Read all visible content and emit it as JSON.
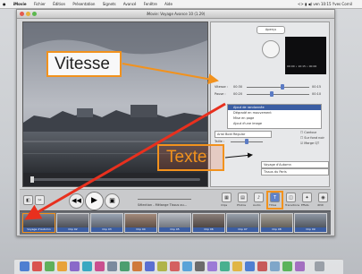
{
  "menubar": {
    "apple": "",
    "items": [
      "iMovie",
      "Fichier",
      "Édition",
      "Présentation",
      "Signets",
      "Avancé",
      "Fenêtre",
      "Aide"
    ],
    "status": "<> ▮ ◀) ven 10:15 Yves Cornil"
  },
  "window": {
    "title": "iMovie: Voyage Avance 10 (1.29)"
  },
  "panel": {
    "apercu_label": "Aperçu",
    "timecode": "00:00 • 10:15 • 00:00",
    "vitesse_label": "Vitesse :",
    "vitesse_start": "00:30",
    "vitesse_end": "00:15",
    "pause_label": "Pause :",
    "pause_start": "00:20",
    "pause_end": "00:10",
    "list_items": [
      "Ajout de randonnée",
      "Dégradé en mouvement",
      "Mise en page",
      "Ajout d'une image"
    ],
    "font_select": "Arial Bold Regular",
    "taille_label": "Taille :",
    "checkbox_contour": "Contour",
    "checkbox_fond": "Sur fond noir",
    "checkbox_marge": "Marge QT",
    "text_field_1": "Voyage d'Automn",
    "text_field_2": "Tissus du Paris"
  },
  "toolbar": {
    "sound_labels": [
      "Durée",
      "Montage"
    ],
    "buttons": [
      "Clips",
      "Photos",
      "Audio",
      "Titres",
      "Transitions",
      "Effets",
      "iDVD"
    ],
    "duration_text": "Sélection - Mélange Tissus ou..."
  },
  "clips": [
    {
      "label": "Voyage d'Automn"
    },
    {
      "label": "Clip 02"
    },
    {
      "label": "Clip 03"
    },
    {
      "label": "Clip 04"
    },
    {
      "label": "Clip 05"
    },
    {
      "label": "Clip 06"
    },
    {
      "label": "Clip 07"
    },
    {
      "label": "Clip 08"
    },
    {
      "label": "Clip 09"
    }
  ],
  "annotations": {
    "vitesse": "Vitesse",
    "texte": "Texte"
  },
  "colors": {
    "annotation_orange": "#f2921d",
    "arrow_red": "#e8301e",
    "selection_blue": "#3a5da3"
  }
}
